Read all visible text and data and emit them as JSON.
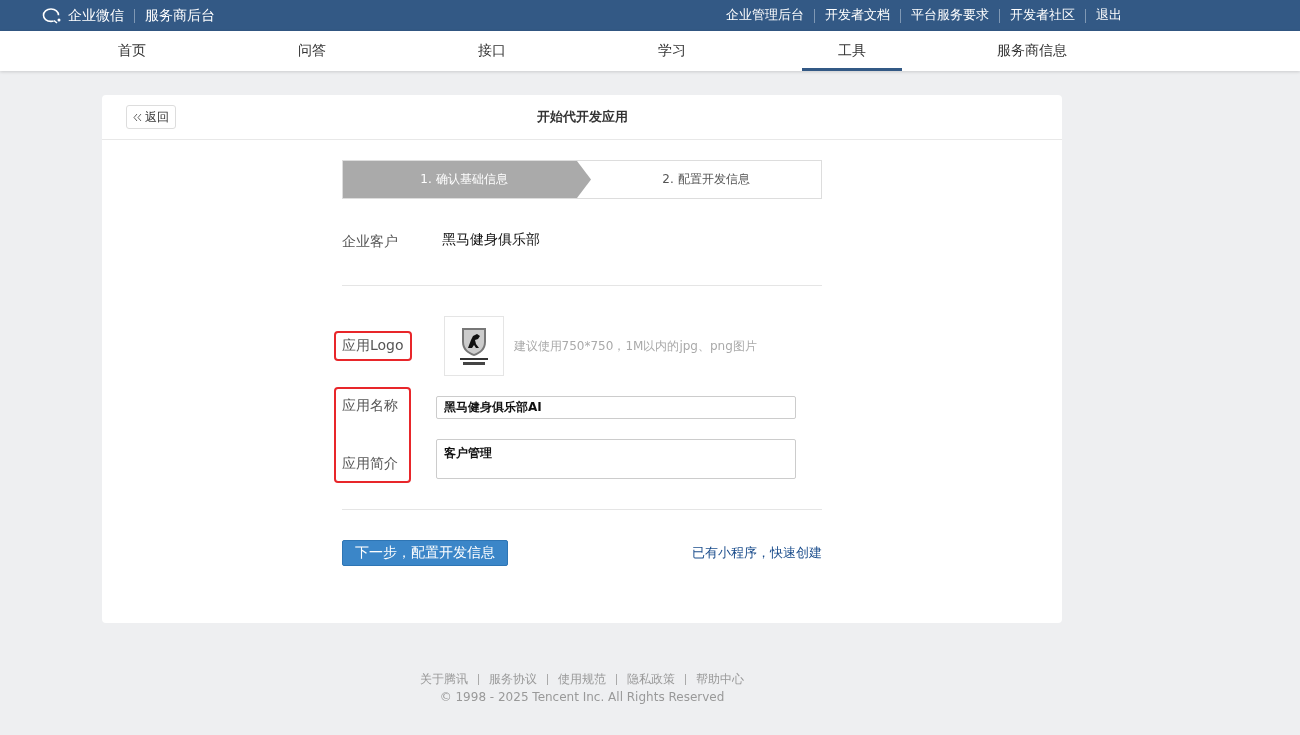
{
  "top_bar": {
    "brand": "企业微信",
    "subtitle": "服务商后台",
    "links": [
      "企业管理后台",
      "开发者文档",
      "平台服务要求",
      "开发者社区",
      "退出"
    ]
  },
  "nav": {
    "tabs": [
      {
        "label": "首页",
        "selected": false
      },
      {
        "label": "问答",
        "selected": false
      },
      {
        "label": "接口",
        "selected": false
      },
      {
        "label": "学习",
        "selected": false
      },
      {
        "label": "工具",
        "selected": true
      },
      {
        "label": "服务商信息",
        "selected": false
      }
    ]
  },
  "card": {
    "back_button": "返回",
    "title": "开始代开发应用",
    "steps": [
      {
        "label": "1. 确认基础信息",
        "selected": true
      },
      {
        "label": "2. 配置开发信息",
        "selected": false
      }
    ],
    "customer": {
      "label": "企业客户",
      "value": "黑马健身俱乐部"
    },
    "logo_row": {
      "label": "应用Logo",
      "highlighted": true,
      "hint": "建议使用750*750，1M以内的jpg、png图片"
    },
    "highlight_group": {
      "highlighted": true,
      "rows": [
        {
          "kind": "input",
          "label": "应用名称",
          "value": "黑马健身俱乐部AI"
        },
        {
          "kind": "textarea",
          "label": "应用简介",
          "value": "客户管理"
        }
      ]
    },
    "next_button": "下一步，配置开发信息",
    "mini_program": {
      "text": "已有小程序，",
      "link": "快速创建"
    }
  },
  "footer": {
    "links": [
      "关于腾讯",
      "服务协议",
      "使用规范",
      "隐私政策",
      "帮助中心"
    ],
    "copyright": "© 1998 - 2025 Tencent Inc. All Rights Reserved"
  }
}
